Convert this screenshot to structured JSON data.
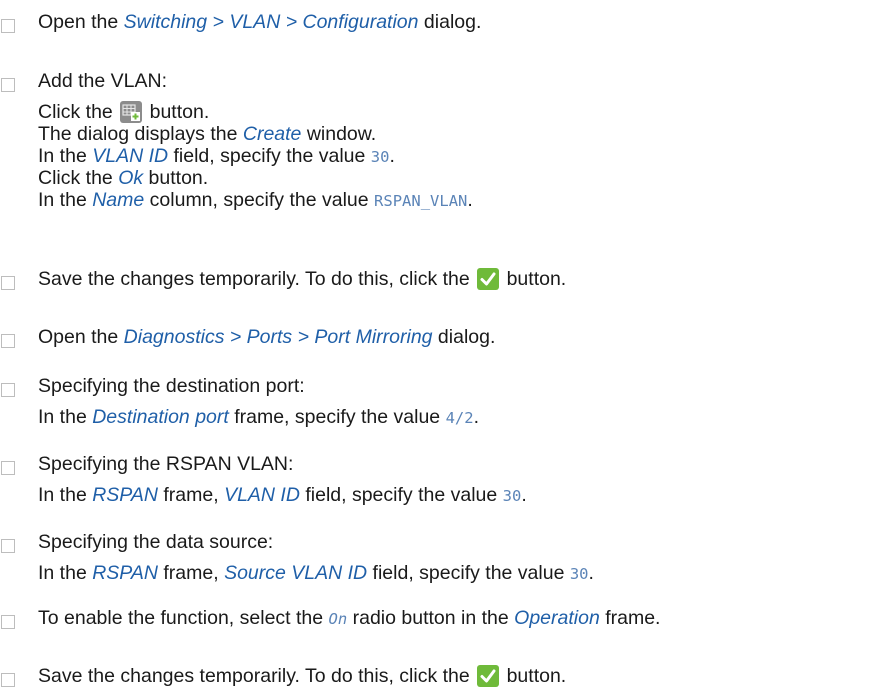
{
  "steps": [
    {
      "lines": [
        [
          {
            "t": "Open the "
          },
          {
            "u": "Switching > VLAN > Configuration"
          },
          {
            "t": " dialog."
          }
        ]
      ]
    },
    {
      "lines": [
        [
          {
            "t": "Add the VLAN:"
          }
        ],
        [
          {
            "t": "Click the "
          },
          {
            "icon": "add-table-icon"
          },
          {
            "t": " button."
          }
        ],
        [
          {
            "t": "The dialog displays the "
          },
          {
            "u": "Create"
          },
          {
            "t": " window."
          }
        ],
        [
          {
            "t": "In the "
          },
          {
            "u": "VLAN ID"
          },
          {
            "t": " field, specify the value "
          },
          {
            "v": "30"
          },
          {
            "t": "."
          }
        ],
        [
          {
            "t": "Click the "
          },
          {
            "u": "Ok"
          },
          {
            "t": " button."
          }
        ],
        [
          {
            "t": "In the "
          },
          {
            "u": "Name"
          },
          {
            "t": " column, specify the value "
          },
          {
            "v": "RSPAN_VLAN"
          },
          {
            "t": "."
          }
        ]
      ]
    },
    {
      "lines": [
        [
          {
            "t": "Save the changes temporarily. To do this, click the "
          },
          {
            "icon": "checkmark-icon"
          },
          {
            "t": " button."
          }
        ]
      ]
    },
    {
      "lines": [
        [
          {
            "t": "Open the "
          },
          {
            "u": "Diagnostics > Ports > Port Mirroring"
          },
          {
            "t": " dialog."
          }
        ]
      ]
    },
    {
      "lines": [
        [
          {
            "t": "Specifying the destination port:"
          }
        ],
        [
          {
            "t": "In the "
          },
          {
            "u": "Destination port"
          },
          {
            "t": " frame, specify the value "
          },
          {
            "v": "4/2"
          },
          {
            "t": "."
          }
        ]
      ]
    },
    {
      "lines": [
        [
          {
            "t": "Specifying the RSPAN VLAN:"
          }
        ],
        [
          {
            "t": "In the "
          },
          {
            "u": "RSPAN"
          },
          {
            "t": " frame, "
          },
          {
            "u": "VLAN ID"
          },
          {
            "t": " field, specify the value "
          },
          {
            "v": "30"
          },
          {
            "t": "."
          }
        ]
      ]
    },
    {
      "lines": [
        [
          {
            "t": "Specifying the data source:"
          }
        ],
        [
          {
            "t": "In the "
          },
          {
            "u": "RSPAN"
          },
          {
            "t": " frame, "
          },
          {
            "u": "Source VLAN ID"
          },
          {
            "t": " field, specify the value "
          },
          {
            "v": "30"
          },
          {
            "t": "."
          }
        ]
      ]
    },
    {
      "lines": [
        [
          {
            "t": "To enable the function, select the "
          },
          {
            "vi": "On"
          },
          {
            "t": " radio button in the "
          },
          {
            "u": "Operation"
          },
          {
            "t": " frame."
          }
        ]
      ]
    },
    {
      "lines": [
        [
          {
            "t": "Save the changes temporarily. To do this, click the "
          },
          {
            "icon": "checkmark-icon"
          },
          {
            "t": " button."
          }
        ]
      ]
    }
  ]
}
